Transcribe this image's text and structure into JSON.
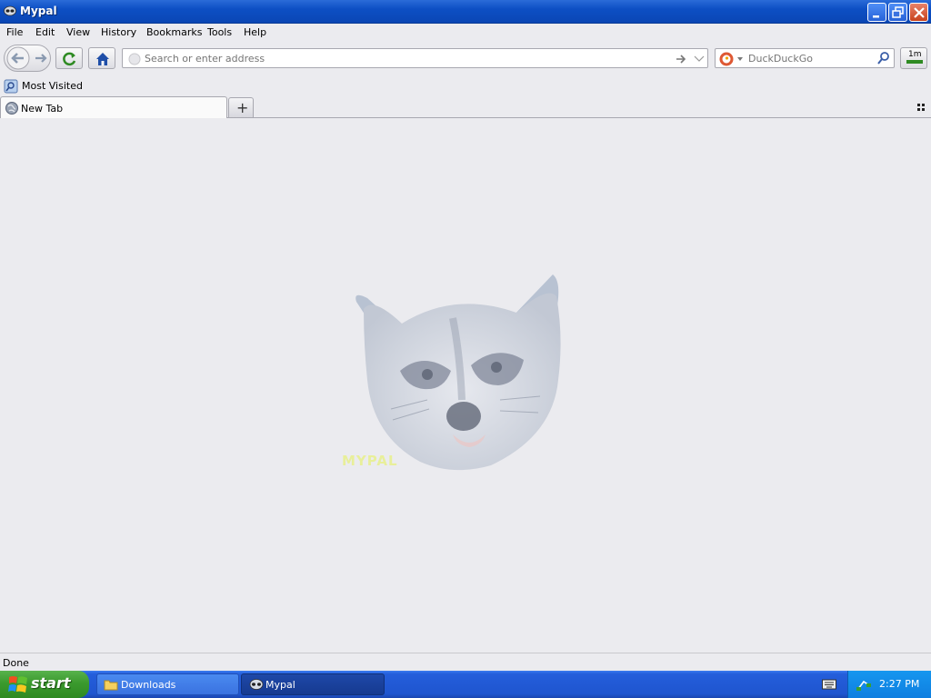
{
  "window": {
    "title": "Mypal",
    "controls": {
      "minimize": "minimize",
      "restore": "restore",
      "close": "close"
    }
  },
  "menu": {
    "items": [
      "File",
      "Edit",
      "View",
      "History",
      "Bookmarks",
      "Tools",
      "Help"
    ]
  },
  "toolbar": {
    "url_placeholder": "Search or enter address",
    "search_engine": "DuckDuckGo",
    "extension_badge": "1m"
  },
  "bookmarks": {
    "items": [
      {
        "label": "Most Visited",
        "icon": "bookmark-folder-icon"
      }
    ]
  },
  "tabs": {
    "items": [
      {
        "label": "New Tab",
        "icon": "globe-icon",
        "active": true
      }
    ],
    "new_tab_symbol": "+"
  },
  "content": {
    "mascot": "raccoon-head",
    "brand_text": "MYPAL"
  },
  "status": {
    "text": "Done"
  },
  "taskbar": {
    "start_label": "start",
    "tasks": [
      {
        "label": "Downloads",
        "icon": "folder-icon",
        "active": false
      },
      {
        "label": "Mypal",
        "icon": "mypal-icon",
        "active": true
      }
    ],
    "clock": "2:27 PM"
  },
  "colors": {
    "titlebar": "#0d4fc4",
    "chrome": "#ebebef",
    "taskbar": "#245edb",
    "start": "#3b9a2e",
    "tray": "#0f7fe0"
  }
}
